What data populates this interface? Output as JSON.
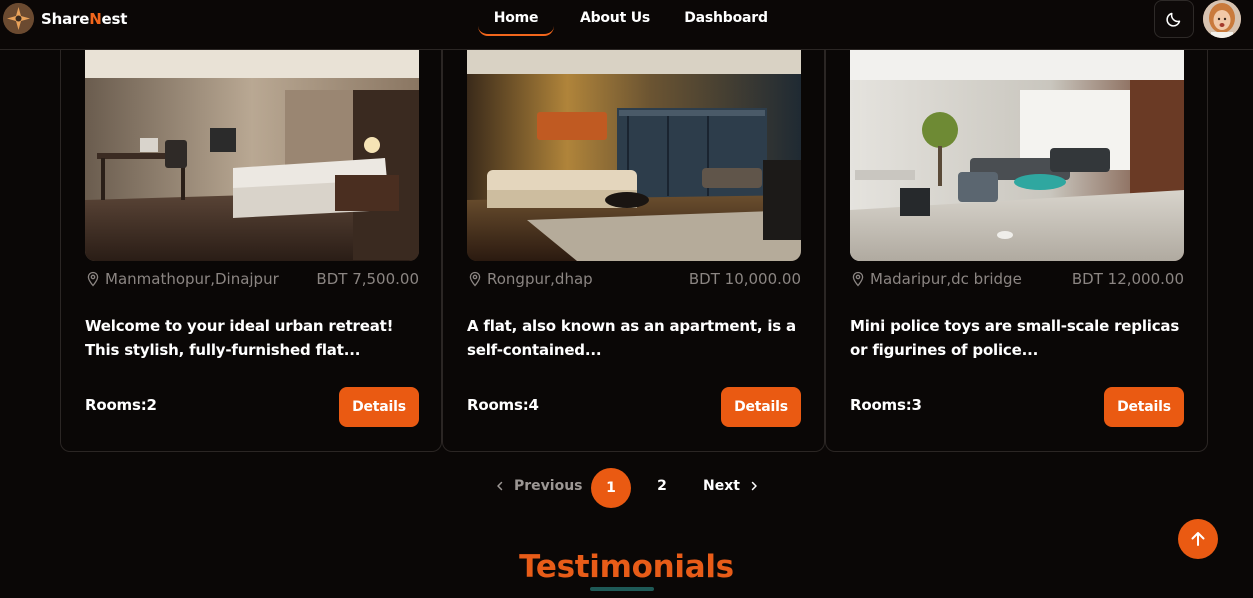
{
  "brand": {
    "name_part1": "Share",
    "name_accent": "N",
    "name_part2": "est",
    "accent_color": "#f2661c"
  },
  "nav": {
    "home": "Home",
    "about": "About Us",
    "dashboard": "Dashboard"
  },
  "header_icons": {
    "theme_toggle": "moon-icon",
    "avatar": "user-avatar"
  },
  "listings": [
    {
      "location": "Manmathopur,Dinajpur",
      "price": "BDT 7,500.00",
      "description": "Welcome to your ideal urban retreat! This stylish, fully-furnished flat...",
      "rooms": "Rooms:2",
      "button": "Details"
    },
    {
      "location": "Rongpur,dhap",
      "price": "BDT 10,000.00",
      "description": "A flat, also known as an apartment, is a self-contained...",
      "rooms": "Rooms:4",
      "button": "Details"
    },
    {
      "location": "Madaripur,dc bridge",
      "price": "BDT 12,000.00",
      "description": "Mini police toys are small-scale replicas or figurines of police...",
      "rooms": "Rooms:3",
      "button": "Details"
    }
  ],
  "pagination": {
    "previous": "Previous",
    "page1": "1",
    "page2": "2",
    "next": "Next",
    "current_page": 1
  },
  "section_title": "Testimonials",
  "colors": {
    "primary": "#ea5a12",
    "background": "#0a0706",
    "muted_text": "#8b8582",
    "underline": "#1f5a57"
  }
}
